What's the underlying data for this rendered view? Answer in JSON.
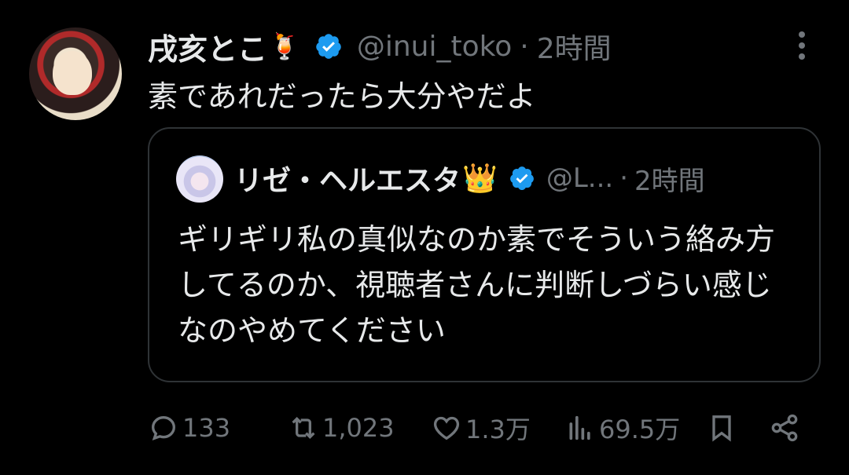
{
  "tweet": {
    "author_name": "戌亥とこ",
    "author_emoji": "🍹",
    "handle": "@inui_toko",
    "separator": "·",
    "time": "2時間",
    "text": "素であれだったら大分やだよ"
  },
  "quote": {
    "author_name": "リゼ・ヘルエスタ",
    "author_emoji": "👑",
    "handle": "@L...",
    "separator": "·",
    "time": "2時間",
    "text": "ギリギリ私の真似なのか素でそういう絡み方してるのか、視聴者さんに判断しづらい感じなのやめてください"
  },
  "actions": {
    "replies": "133",
    "reposts": "1,023",
    "likes": "1.3万",
    "views": "69.5万"
  },
  "colors": {
    "background": "#000000",
    "text": "#e7e9ea",
    "secondary": "#71767b",
    "verified": "#1d9bf0",
    "border": "#2f3336"
  },
  "icons": [
    "more-icon",
    "verified-icon",
    "reply-icon",
    "repost-icon",
    "like-icon",
    "views-icon",
    "bookmark-icon",
    "share-icon"
  ]
}
